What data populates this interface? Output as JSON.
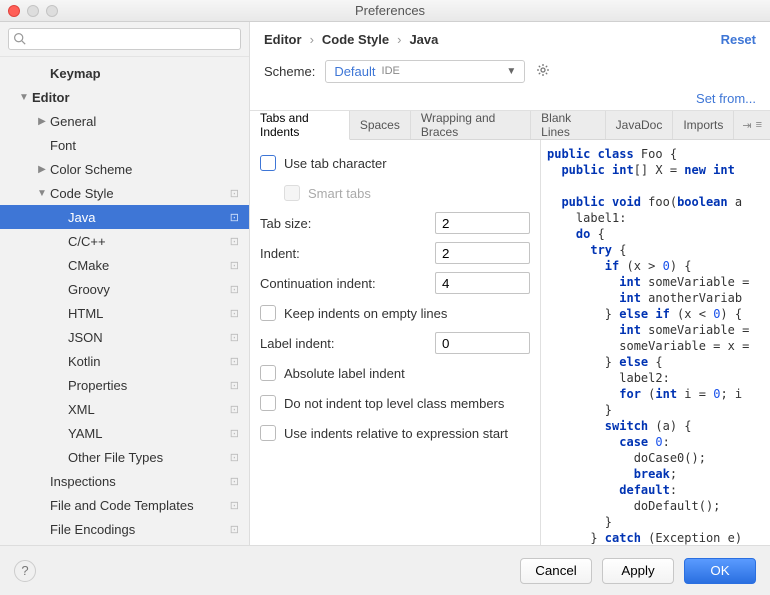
{
  "window": {
    "title": "Preferences"
  },
  "sidebar": {
    "search_placeholder": "",
    "items": [
      {
        "label": "Keymap",
        "level": 1,
        "bold": true
      },
      {
        "label": "Editor",
        "level": 0,
        "bold": true,
        "arrow": "down"
      },
      {
        "label": "General",
        "level": 1,
        "arrow": "right"
      },
      {
        "label": "Font",
        "level": 1
      },
      {
        "label": "Color Scheme",
        "level": 1,
        "arrow": "right"
      },
      {
        "label": "Code Style",
        "level": 1,
        "arrow": "down",
        "gear": true
      },
      {
        "label": "Java",
        "level": 2,
        "gear": true,
        "selected": true
      },
      {
        "label": "C/C++",
        "level": 2,
        "gear": true
      },
      {
        "label": "CMake",
        "level": 2,
        "gear": true
      },
      {
        "label": "Groovy",
        "level": 2,
        "gear": true
      },
      {
        "label": "HTML",
        "level": 2,
        "gear": true
      },
      {
        "label": "JSON",
        "level": 2,
        "gear": true
      },
      {
        "label": "Kotlin",
        "level": 2,
        "gear": true
      },
      {
        "label": "Properties",
        "level": 2,
        "gear": true
      },
      {
        "label": "XML",
        "level": 2,
        "gear": true
      },
      {
        "label": "YAML",
        "level": 2,
        "gear": true
      },
      {
        "label": "Other File Types",
        "level": 2,
        "gear": true
      },
      {
        "label": "Inspections",
        "level": 1,
        "gear": true
      },
      {
        "label": "File and Code Templates",
        "level": 1,
        "gear": true
      },
      {
        "label": "File Encodings",
        "level": 1,
        "gear": true
      }
    ]
  },
  "breadcrumb": {
    "p0": "Editor",
    "p1": "Code Style",
    "p2": "Java",
    "reset": "Reset"
  },
  "scheme": {
    "label": "Scheme:",
    "name": "Default",
    "tag": "IDE",
    "setfrom": "Set from..."
  },
  "tabs": [
    "Tabs and Indents",
    "Spaces",
    "Wrapping and Braces",
    "Blank Lines",
    "JavaDoc",
    "Imports"
  ],
  "form": {
    "use_tab": "Use tab character",
    "smart_tabs": "Smart tabs",
    "tab_size_label": "Tab size:",
    "tab_size_val": "2",
    "indent_label": "Indent:",
    "indent_val": "2",
    "cont_label": "Continuation indent:",
    "cont_val": "4",
    "keep_empty": "Keep indents on empty lines",
    "label_indent_label": "Label indent:",
    "label_indent_val": "0",
    "abs_label": "Absolute label indent",
    "no_top": "Do not indent top level class members",
    "rel_expr": "Use indents relative to expression start"
  },
  "footer": {
    "cancel": "Cancel",
    "apply": "Apply",
    "ok": "OK"
  }
}
